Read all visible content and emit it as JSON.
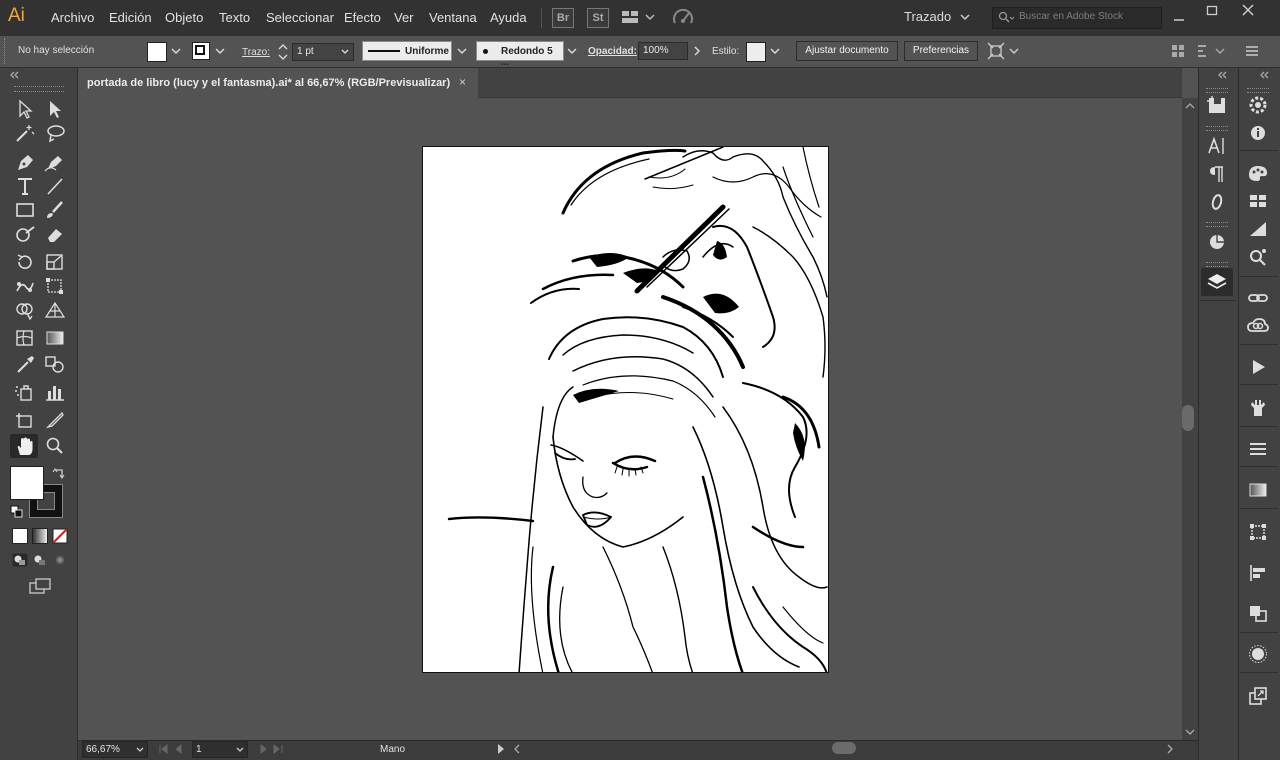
{
  "app": {
    "logo": "Ai",
    "menu": [
      "Archivo",
      "Edición",
      "Objeto",
      "Texto",
      "Seleccionar",
      "Efecto",
      "Ver",
      "Ventana",
      "Ayuda"
    ],
    "bridge_label": "Br",
    "stock_label": "St",
    "workspace": "Trazado",
    "search_placeholder": "Buscar en Adobe Stock"
  },
  "control_bar": {
    "selection_status": "No hay selección",
    "stroke_label": "Trazo:",
    "stroke_weight": "1 pt",
    "profile_label": "Uniforme",
    "brush_label": "Redondo 5 ...",
    "opacity_label": "Opacidad:",
    "opacity_value": "100%",
    "style_label": "Estilo:",
    "fit_document_button": "Ajustar documento",
    "preferences_button": "Preferencias"
  },
  "document": {
    "tab_title": "portada de libro (lucy y el fantasma).ai* al 66,67% (RGB/Previsualizar)",
    "close_glyph": "×"
  },
  "status_bar": {
    "zoom": "66,67%",
    "artboard_number": "1",
    "current_tool": "Mano"
  },
  "colors": {
    "menubar_bg": "#323232",
    "panel_bg": "#424242",
    "canvas_bg": "#535353",
    "logo_orange": "#f7a23b",
    "artboard_bg": "#ffffff"
  }
}
